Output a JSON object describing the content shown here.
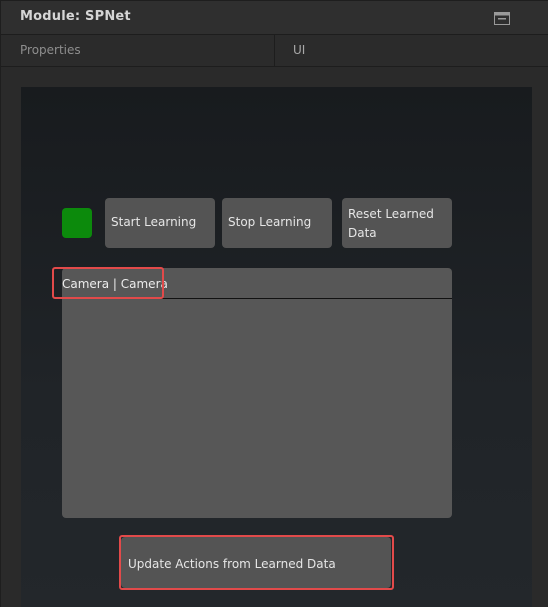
{
  "window": {
    "title": "Module: SPNet",
    "restore_icon": "window-restore-icon"
  },
  "tabs": [
    {
      "label": "Properties"
    },
    {
      "label": "UI"
    }
  ],
  "status": {
    "indicator_color": "#0c8a0c"
  },
  "controls": {
    "start_label": "Start Learning",
    "stop_label": "Stop Learning",
    "reset_label": "Reset Learned Data"
  },
  "camera": {
    "label": "Camera | Camera"
  },
  "update_label": "Update Actions from Learned Data",
  "colors": {
    "accent_highlight": "#e24a4a",
    "button_bg": "#545454"
  }
}
